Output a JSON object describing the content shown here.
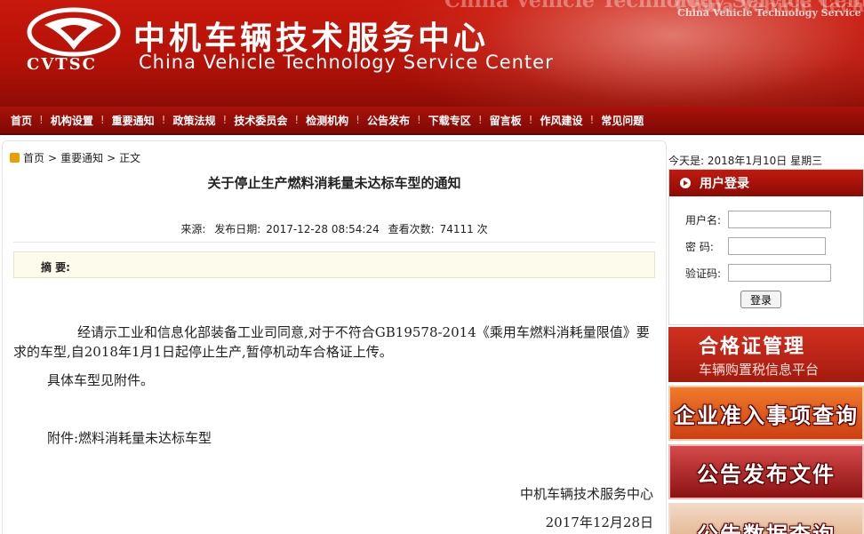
{
  "header": {
    "logo_text": "CVTSC",
    "site_name_cn": "中机车辆技术服务中心",
    "site_name_en": "China Vehicle Technology Service Center",
    "watermark_en": "China Vehicle Technology Service Center"
  },
  "nav": {
    "items": [
      "首页",
      "机构设置",
      "重要通知",
      "政策法规",
      "技术委员会",
      "检测机构",
      "公告发布",
      "下载专区",
      "留言板",
      "作风建设",
      "常见问题"
    ]
  },
  "breadcrumb": {
    "home": "首页",
    "sep": ">",
    "section": "重要通知",
    "current": "正文"
  },
  "article": {
    "title": "关于停止生产燃料消耗量未达标车型的通知",
    "source_label": "来源:",
    "date_label": "发布日期:",
    "date_value": "2017-12-28 08:54:24",
    "views_label": "查看次数:",
    "views_value": "74111 次",
    "summary_label": "摘 要:",
    "paragraph1": "经请示工业和信息化部装备工业司同意,对于不符合GB19578-2014《乘用车燃料消耗量限值》要求的车型,自2018年1月1日起停止生产,暂停机动车合格证上传。",
    "paragraph2": "具体车型见附件。",
    "attachment": "附件:燃料消耗量未达标车型",
    "signature_org": "中机车辆技术服务中心",
    "signature_date": "2017年12月28日"
  },
  "sidebar": {
    "today": "今天是: 2018年1月10日 星期三",
    "login": {
      "title": "用户登录",
      "username_label": "用户名:",
      "password_label": "密 码:",
      "captcha_label": "验证码:",
      "button_label": "登录"
    },
    "promos": [
      {
        "line1": "合格证管理",
        "line2": "车辆购置税信息平台"
      },
      {
        "line1": "企业准入事项查询"
      },
      {
        "line1": "公告发布文件"
      },
      {
        "line1": "公告数据查询"
      }
    ]
  },
  "colors": {
    "brand_red": "#b51208",
    "nav_red": "#8e0c05",
    "summary_bg": "#fdfbec"
  },
  "icons": [
    "cvtsc-logo-icon",
    "home-icon",
    "arrow-bullet-icon"
  ]
}
